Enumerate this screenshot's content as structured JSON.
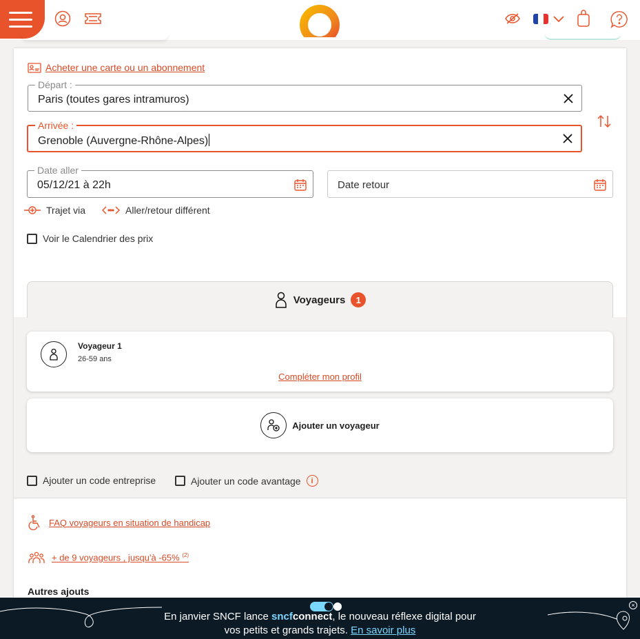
{
  "topbar": {
    "menu_icon": "hamburger-icon",
    "account_icon": "user-icon",
    "ticket_icon": "ticket-icon",
    "visibility_icon": "eye-slash-icon",
    "language": "fr",
    "cart_icon": "bag-icon",
    "help_icon": "help-icon"
  },
  "form": {
    "buy_card_link": "Acheter une carte ou un abonnement",
    "departure": {
      "label": "Départ :",
      "value": "Paris (toutes gares intramuros)"
    },
    "arrival": {
      "label": "Arrivée :",
      "value": "Grenoble (Auvergne-Rhône-Alpes)"
    },
    "date_out": {
      "label": "Date aller",
      "value": "05/12/21 à 22h"
    },
    "date_return": {
      "placeholder": "Date retour"
    },
    "via_label": "Trajet via",
    "different_return_label": "Aller/retour différent",
    "price_calendar_label": "Voir le Calendrier des prix"
  },
  "travellers": {
    "tab_label": "Voyageurs",
    "count": "1",
    "items": [
      {
        "name": "Voyageur 1",
        "age": "26-59 ans",
        "link": "Compléter mon profil"
      }
    ],
    "add_label": "Ajouter un voyageur"
  },
  "codes": {
    "enterprise_label": "Ajouter un code entreprise",
    "advantage_label": "Ajouter un code avantage"
  },
  "links": {
    "faq_handicap": "FAQ voyageurs en situation de handicap",
    "group_label": "+ de 9 voyageurs , jusqu'à -65%",
    "group_note": "(2)"
  },
  "other_additions": "Autres ajouts",
  "banner": {
    "text_before": "En janvier SNCF lance ",
    "brand_a": "sncf",
    "brand_b": "connect",
    "text_after": ", le nouveau réflexe digital pour",
    "line2": "vos petits et grands trajets. ",
    "link": "En savoir plus"
  },
  "colors": {
    "accent": "#e8532b",
    "banner_bg": "#0c1a26",
    "banner_link": "#7ad7ff"
  }
}
